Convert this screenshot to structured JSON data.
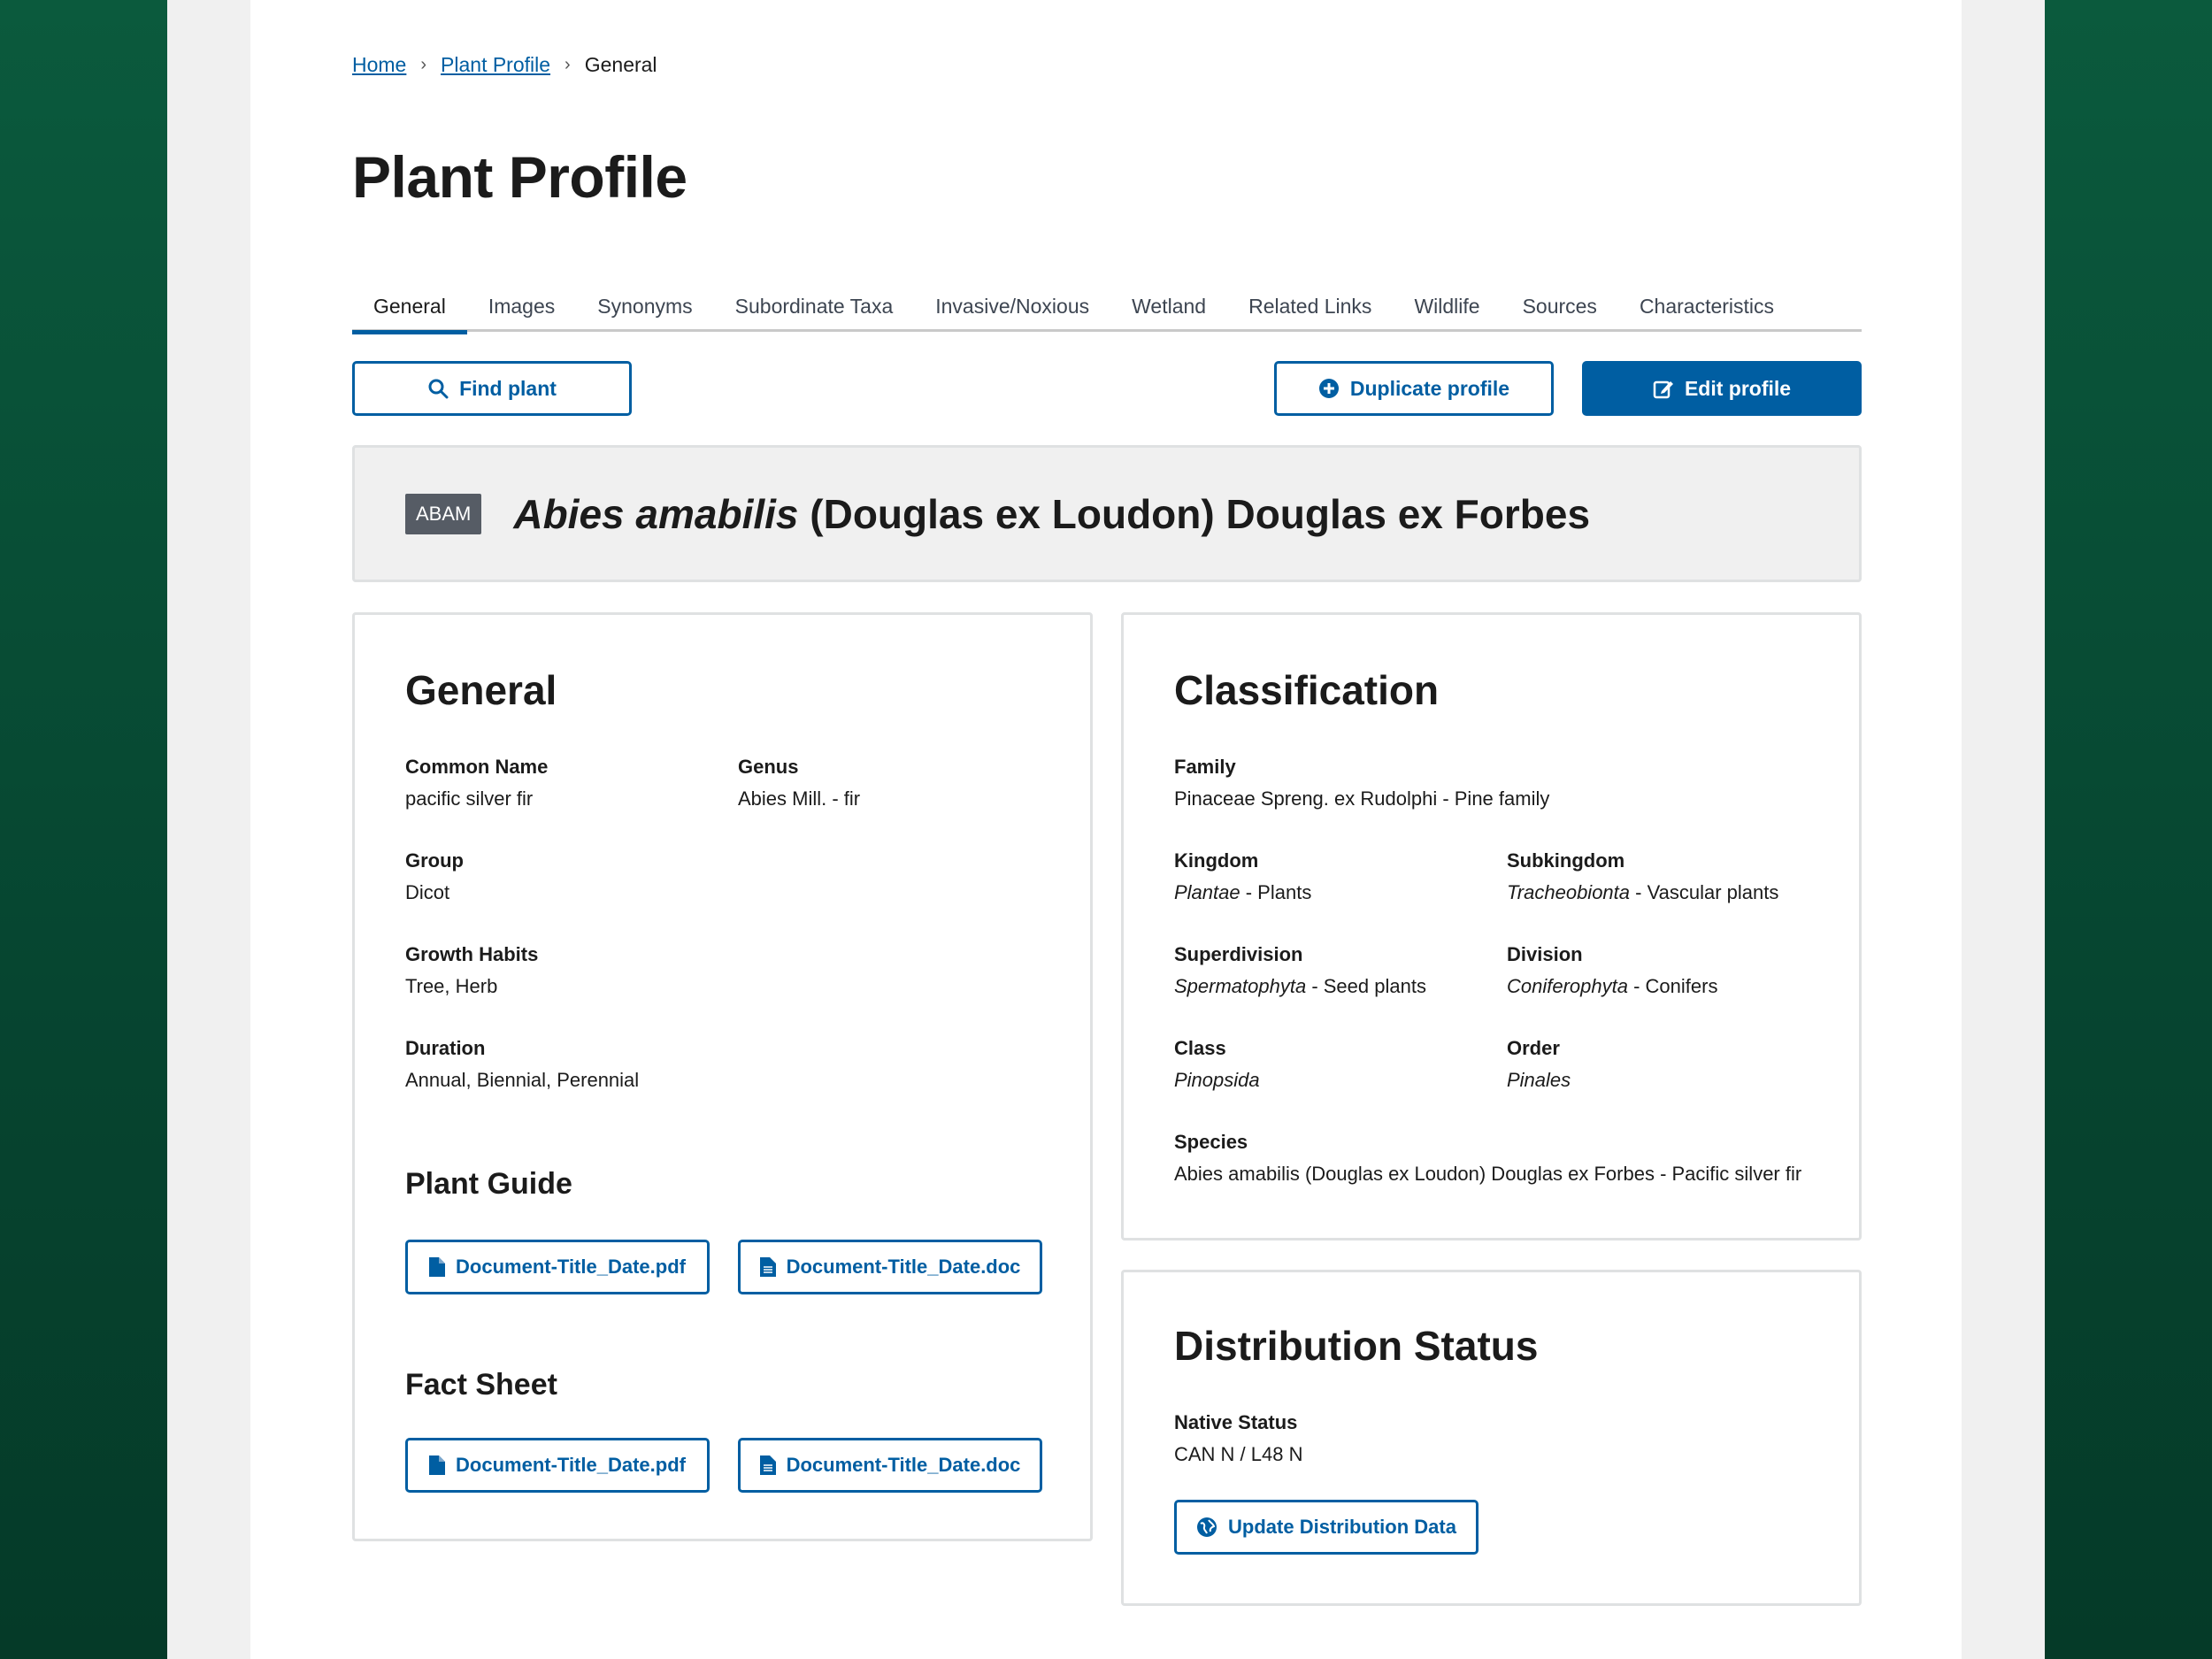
{
  "breadcrumb": {
    "home": "Home",
    "plant_profile": "Plant Profile",
    "current": "General"
  },
  "page_title": "Plant Profile",
  "tabs": [
    {
      "label": "General",
      "active": true
    },
    {
      "label": "Images"
    },
    {
      "label": "Synonyms"
    },
    {
      "label": "Subordinate Taxa"
    },
    {
      "label": "Invasive/Noxious"
    },
    {
      "label": "Wetland"
    },
    {
      "label": "Related Links"
    },
    {
      "label": "Wildlife"
    },
    {
      "label": "Sources"
    },
    {
      "label": "Characteristics"
    }
  ],
  "actions": {
    "find_plant": "Find plant",
    "duplicate_profile": "Duplicate profile",
    "edit_profile": "Edit profile"
  },
  "banner": {
    "symbol": "ABAM",
    "sci_name_italic": "Abies amabilis",
    "sci_name_author": " (Douglas ex Loudon) Douglas ex Forbes"
  },
  "general": {
    "title": "General",
    "common_name_label": "Common Name",
    "common_name": "pacific silver fir",
    "genus_label": "Genus",
    "genus": "Abies Mill. - fir",
    "group_label": "Group",
    "group": "Dicot",
    "growth_habits_label": "Growth Habits",
    "growth_habits": "Tree, Herb",
    "duration_label": "Duration",
    "duration": "Annual, Biennial, Perennial",
    "plant_guide_title": "Plant Guide",
    "plant_guide_pdf": "Document-Title_Date.pdf",
    "plant_guide_doc": "Document-Title_Date.doc",
    "fact_sheet_title": "Fact Sheet",
    "fact_sheet_pdf": "Document-Title_Date.pdf",
    "fact_sheet_doc": "Document-Title_Date.doc"
  },
  "classification": {
    "title": "Classification",
    "family_label": "Family",
    "family": "Pinaceae Spreng. ex Rudolphi - Pine family",
    "kingdom_label": "Kingdom",
    "kingdom_italic": "Plantae",
    "kingdom_rest": " - Plants",
    "subkingdom_label": "Subkingdom",
    "subkingdom_italic": "Tracheobionta",
    "subkingdom_rest": " - Vascular plants",
    "superdivision_label": "Superdivision",
    "superdivision_italic": "Spermatophyta",
    "superdivision_rest": " - Seed plants",
    "division_label": "Division",
    "division_italic": "Coniferophyta",
    "division_rest": " - Conifers",
    "class_label": "Class",
    "class_italic": "Pinopsida",
    "order_label": "Order",
    "order_italic": "Pinales",
    "species_label": "Species",
    "species": "Abies amabilis (Douglas ex Loudon) Douglas ex Forbes - Pacific silver fir"
  },
  "distribution": {
    "title": "Distribution Status",
    "native_status_label": "Native Status",
    "native_status": "CAN N / L48 N",
    "update_button": "Update Distribution Data"
  },
  "colors": {
    "primary": "#005ea2",
    "background_green": "#0b4d36",
    "badge": "#565c65"
  }
}
